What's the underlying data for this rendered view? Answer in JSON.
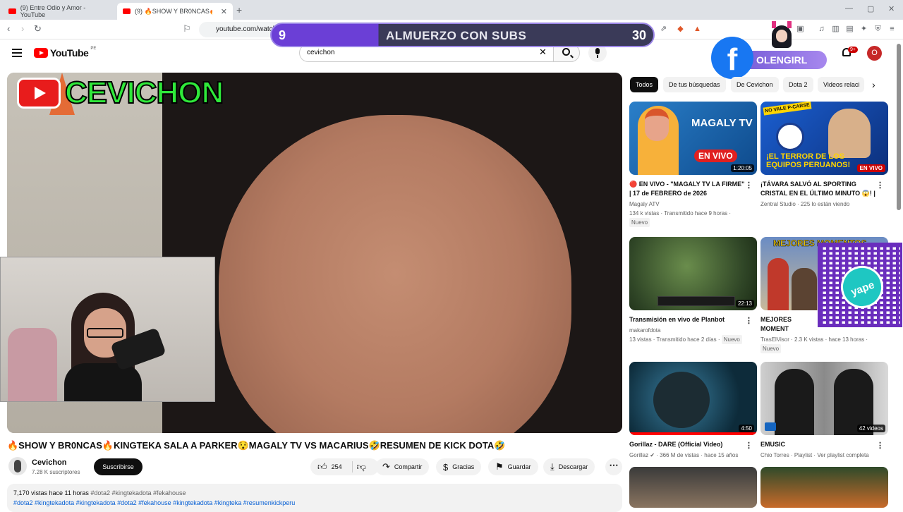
{
  "browser": {
    "tabs": [
      {
        "title": "(9) Entre Odio y Amor - YouTube"
      },
      {
        "title": "(9) 🔥SHOW Y BR0NCAS🔥KING"
      }
    ],
    "address": "youtube.com/watch"
  },
  "overlay": {
    "left_number": "9",
    "center_text": "ALMUERZO CON SUBS",
    "right_number": "30",
    "fb_handle": "OLENGIRL"
  },
  "header": {
    "logo_text": "YouTube",
    "country_code": "PE",
    "search_value": "cevichon",
    "notif_count": "9+",
    "avatar_letter": "O"
  },
  "player": {
    "channel_overlay": "CEVICHON"
  },
  "video": {
    "title": "🔥SHOW Y BR0NCAS🔥KINGTEKA SALA A PARKER😯MAGALY TV VS MACARIUS🤣RESUMEN DE KICK DOTA🤣",
    "channel": "Cevichon",
    "subscribers": "7.28 K suscriptores",
    "subscribe_label": "Suscribirse",
    "likes": "254",
    "share_label": "Compartir",
    "thanks_label": "Gracias",
    "save_label": "Guardar",
    "download_label": "Descargar",
    "views_time": "7,170 vistas  hace 11 horas",
    "inline_tags": "#dota2 #kingtekadota #fekahouse",
    "hashtags": "#dota2 #kingtekadota #kingtekadota #dota2 #fekahouse #kingtekadota #kingteka  #resumenkickperu"
  },
  "chips": [
    "Todos",
    "De tus búsquedas",
    "De Cevichon",
    "Dota 2",
    "Videos relaci"
  ],
  "recommendations": [
    {
      "title": "🔴 EN VIVO - \"MAGALY TV LA FIRME\" | 17 de FEBRERO de 2026",
      "channel": "Magaly ATV",
      "meta": "134 k vistas · Transmitido hace 9 horas ·",
      "badge": "Nuevo",
      "duration": "1:20:05",
      "thumb_text": "MAGALY TV",
      "thumb_sub": "EN VIVO"
    },
    {
      "title": "¡TÁVARA SALVÓ AL SPORTING CRISTAL EN EL ÚLTIMO MINUTO 😱! | ...",
      "channel": "Zentral Studio · 225 lo están viendo",
      "meta": "",
      "badge": "",
      "duration": "EN VIVO",
      "thumb_text": "¡EL TERROR DE LOS EQUIPOS PERUANOS!",
      "thumb_sub": "NO VALE P-CARSE"
    },
    {
      "title": "Transmisión en vivo de Planbot",
      "channel": "makarofdota",
      "meta": "13 vistas · Transmitido hace 2 días ·",
      "badge": "Nuevo",
      "duration": "22:13",
      "thumb_text": "",
      "thumb_sub": ""
    },
    {
      "title": "MEJORES MOMENT FEBRERO 09",
      "channel": "TrasElVisor · 2.3 K vistas · hace 13 horas ·",
      "meta": "",
      "badge": "Nuevo",
      "duration": "",
      "thumb_text": "MEJORES MOMENTOS",
      "thumb_sub": "yape"
    },
    {
      "title": "Gorillaz - DARE (Official Video)",
      "channel": "Gorillaz ✔ · 366 M de vistas · hace 15 años",
      "meta": "",
      "badge": "",
      "duration": "4:50",
      "thumb_text": "",
      "thumb_sub": ""
    },
    {
      "title": "EMUSIC",
      "channel": "Chio Torres · Playlist · Ver playlist completa",
      "meta": "",
      "badge": "",
      "duration": "42 videos",
      "thumb_text": "",
      "thumb_sub": ""
    }
  ]
}
